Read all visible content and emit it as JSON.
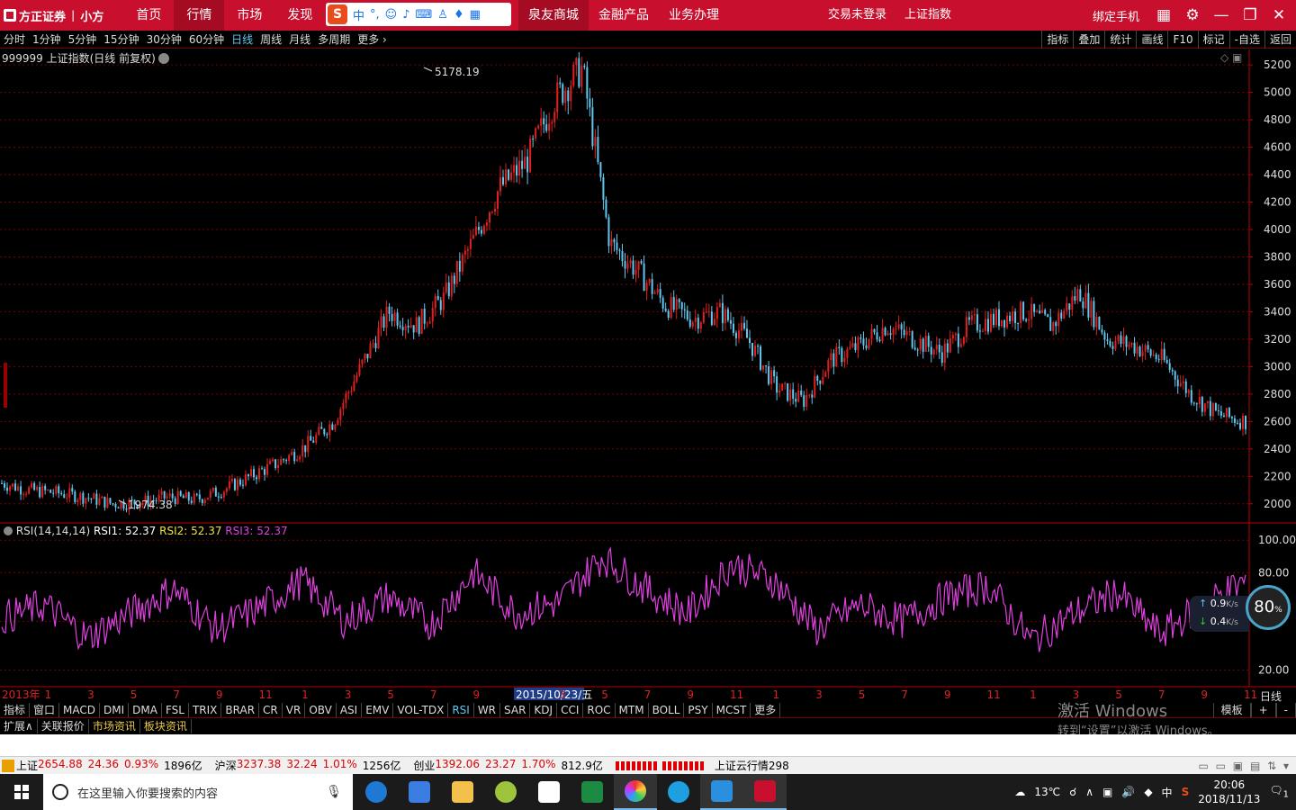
{
  "topbar": {
    "brand": "方正证券",
    "sub_brand": "小方",
    "nav": [
      "首页",
      "行情",
      "市场",
      "发现"
    ],
    "nav_active": 1,
    "ime_label": "中",
    "nav2": [
      "泉友商城",
      "金融产品",
      "业务办理"
    ],
    "trade_status": "交易未登录",
    "current_index": "上证指数",
    "bind_phone": "绑定手机"
  },
  "toolbar": {
    "periods": [
      "分时",
      "1分钟",
      "5分钟",
      "15分钟",
      "30分钟",
      "60分钟",
      "日线",
      "周线",
      "月线",
      "多周期",
      "更多"
    ],
    "active_period": 6,
    "tools": [
      "指标",
      "叠加",
      "统计",
      "画线",
      "F10",
      "标记",
      "-自选",
      "返回"
    ]
  },
  "main_chart": {
    "title": "999999 上证指数(日线 前复权)",
    "high_label": "5178.19",
    "low_label": "1974.38"
  },
  "rsi_panel": {
    "title": "RSI(14,14,14)",
    "rsi1": "RSI1: 52.37",
    "rsi2": "RSI2: 52.37",
    "rsi3": "RSI3: 52.37"
  },
  "chart_data": [
    {
      "type": "line",
      "title": "999999 上证指数(日线 前复权)",
      "y_ticks": [
        2000,
        2200,
        2400,
        2600,
        2800,
        3000,
        3200,
        3400,
        3600,
        3800,
        4000,
        4200,
        4400,
        4600,
        4800,
        5000,
        5200
      ],
      "ylim": [
        1900,
        5260
      ],
      "x": [
        0,
        3,
        6,
        9,
        12,
        15,
        18,
        21,
        24,
        27,
        30,
        33,
        36,
        39,
        42,
        45,
        48,
        51,
        54,
        57,
        60,
        63,
        66,
        69,
        72
      ],
      "series": [
        {
          "values": [
            2150,
            2100,
            2080,
            2050,
            2000,
            2010,
            2050,
            2030,
            2100,
            2200,
            2300,
            2420,
            2600,
            3000,
            3400,
            3300,
            3500,
            3900,
            4300,
            4500,
            4950,
            5178,
            3900,
            3700,
            3450
          ]
        }
      ],
      "x_tick_labels": [
        "2013年",
        "1",
        "3",
        "5",
        "7",
        "9",
        "11",
        "1",
        "3",
        "5",
        "7",
        "9",
        "2015/10/23/五",
        "3",
        "5",
        "7",
        "9",
        "11",
        "1",
        "3",
        "5",
        "7",
        "9",
        "11",
        "1",
        "3",
        "5",
        "7",
        "9",
        "11"
      ],
      "grid": true,
      "annotations": [
        "5178.19",
        "1974.38"
      ]
    },
    {
      "type": "line",
      "title": "RSI(14,14,14)",
      "y_ticks": [
        20,
        50,
        80,
        100
      ],
      "ylim": [
        12,
        104
      ],
      "series": [
        {
          "name": "RSI1",
          "values": [
            52,
            60,
            40,
            55,
            70,
            45,
            58,
            75,
            50,
            65,
            48,
            80,
            55,
            62,
            90,
            70,
            55,
            85,
            75,
            45,
            60,
            50,
            65,
            72,
            38,
            55,
            68,
            42,
            60,
            75
          ]
        }
      ],
      "grid": true
    }
  ],
  "rsi_labels": {
    "right_top": "100.00",
    "right_mid": "80.00",
    "right_low": "20.00"
  },
  "net_widget": {
    "up": "0.9",
    "down": "0.4",
    "unit": "K/s",
    "percent": "80"
  },
  "period_label": "日线",
  "indicator_tabs": [
    "指标",
    "窗口",
    "MACD",
    "DMI",
    "DMA",
    "FSL",
    "TRIX",
    "BRAR",
    "CR",
    "VR",
    "OBV",
    "ASI",
    "EMV",
    "VOL-TDX",
    "RSI",
    "WR",
    "SAR",
    "KDJ",
    "CCI",
    "ROC",
    "MTM",
    "BOLL",
    "PSY",
    "MCST",
    "更多"
  ],
  "indicator_active": 14,
  "indicator_right": [
    "模板",
    "+",
    "-"
  ],
  "sub_tabs": [
    "扩展∧",
    "关联报价",
    "市场资讯",
    "板块资讯"
  ],
  "watermark": {
    "line1": "激活 Windows",
    "line2": "转到“设置”以激活 Windows。"
  },
  "status": {
    "sh": {
      "name": "上证",
      "value": "2654.88",
      "chg": "24.36",
      "pct": "0.93%",
      "vol": "1896亿"
    },
    "hs": {
      "name": "沪深",
      "value": "3237.38",
      "chg": "32.24",
      "pct": "1.01%",
      "vol": "1256亿"
    },
    "cy": {
      "name": "创业",
      "value": "1392.06",
      "chg": "23.27",
      "pct": "1.70%",
      "vol": "812.9亿"
    },
    "cloud": "上证云行情298"
  },
  "taskbar": {
    "search_placeholder": "在这里输入你要搜索的内容",
    "weather": "13℃",
    "ime": "中",
    "time": "20:06",
    "date": "2018/11/13",
    "notification_count": "1"
  },
  "colors": {
    "up": "#e02020",
    "down": "#5ec9f0",
    "rsi": "#e040e0",
    "grid": "#7a0000",
    "brand": "#c8102e"
  }
}
